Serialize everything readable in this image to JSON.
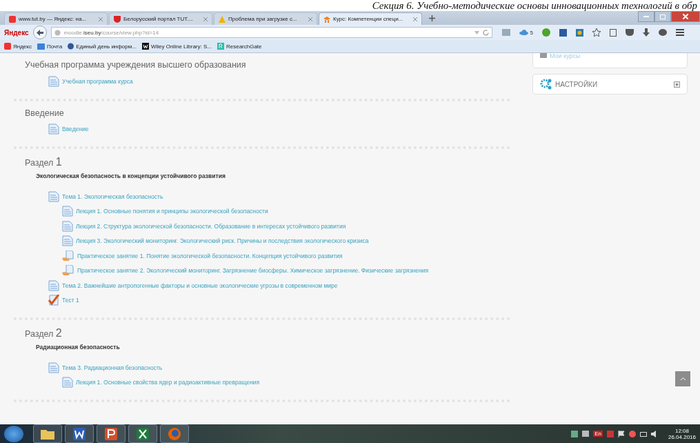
{
  "document_heading": "Секция 6. Учебно-методические основы инновационных технологий в обр",
  "tabs": [
    {
      "label": "www.tut.by — Яндекс: на...",
      "selected": false
    },
    {
      "label": "Белорусский портал TUT....",
      "selected": false
    },
    {
      "label": "Проблема при загрузке с...",
      "selected": false
    },
    {
      "label": "Курс: Компетенции специ...",
      "selected": true
    }
  ],
  "toolbar": {
    "brand": "Яндекс",
    "url": "moodle.**iseu.by**/course/view.php?id=14",
    "cloud_count": "5"
  },
  "bookmarks": [
    "Яндекс",
    "Почта",
    "Единый день информ...",
    "Wiley Online Library: S...",
    "ResearchGate"
  ],
  "sections": [
    {
      "title": "Учебная программа учреждения высшего образования",
      "activities": [
        {
          "kind": "page",
          "label": "Учебная программа курса"
        }
      ]
    },
    {
      "title": "Введение",
      "activities": [
        {
          "kind": "page",
          "label": "Введение"
        }
      ]
    },
    {
      "title": "Раздел",
      "number": "1",
      "summary": "Экологическая безопасность в концепции устойчивого развития",
      "activities": [
        {
          "kind": "page",
          "label": "Тема 1. Экологическая безопасность",
          "children": [
            {
              "kind": "page",
              "label": "Лекция 1. Основные понятия и принципы экологической безопасности"
            },
            {
              "kind": "page",
              "label": "Лекция 2. Структура экологической безопасности. Образование в интересах устойчивого развития"
            },
            {
              "kind": "page",
              "label": "Лекция 3. Экологический мониторинг. Экологический риск. Причины и последствия экологического кризиса"
            },
            {
              "kind": "assign",
              "label": "Практическое занятие 1. Понятие экологической безопасности. Концепция устойчивого развития"
            },
            {
              "kind": "assign",
              "label": "Практическое занятие 2. Экологический мониторинг. Загрязнение биосферы. Химическое загрязнение. Физические загрязнения"
            }
          ]
        },
        {
          "kind": "page",
          "label": "Тема 2. Важнейшие антропогенные факторы и основные экологические угрозы в современном мире"
        },
        {
          "kind": "quiz",
          "label": "Тест 1"
        }
      ]
    },
    {
      "title": "Раздел",
      "number": "2",
      "summary": "Радиационная безопасность",
      "activities": [
        {
          "kind": "page",
          "label": "Тема 3. Радиационная безопасность",
          "children": [
            {
              "kind": "page",
              "label": "Лекция 1. Основные свойства ядер и радиоактивные превращения"
            }
          ]
        }
      ]
    }
  ],
  "blocks": [
    {
      "kind": "links",
      "label": "Мои курсы"
    },
    {
      "kind": "settings",
      "label": "НАСТРОЙКИ"
    }
  ],
  "taskbar": {
    "language": "En",
    "time": "12:08",
    "date": "26.04.2016"
  }
}
